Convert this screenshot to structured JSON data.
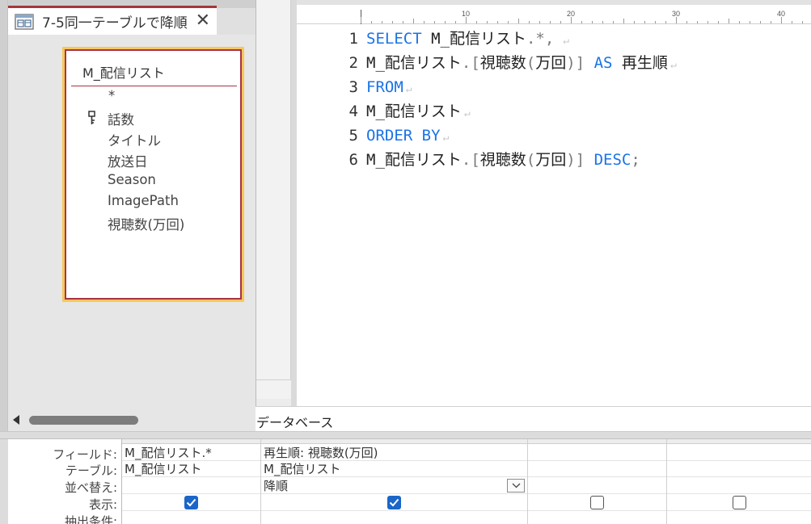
{
  "query_tab": {
    "title": "7-5同一テーブルで降順",
    "close_glyph": "✕"
  },
  "table_box": {
    "name": "M_配信リスト",
    "fields": [
      "*",
      "話数",
      "タイトル",
      "放送日",
      "Season",
      "ImagePath",
      "視聴数(万回)"
    ],
    "key_field_index": 1
  },
  "editor": {
    "ruler_numbers": [
      "10",
      "20",
      "30",
      "40"
    ],
    "lines": [
      {
        "num": "1",
        "tokens": [
          [
            "kw",
            "SELECT"
          ],
          [
            "",
            " M_配信リスト"
          ],
          [
            "pn",
            ".*,"
          ],
          [
            "nl",
            " ↵"
          ]
        ]
      },
      {
        "num": "2",
        "tokens": [
          [
            "",
            "M_配信リスト"
          ],
          [
            "pn",
            ".["
          ],
          [
            "",
            "視聴数"
          ],
          [
            "pn",
            "("
          ],
          [
            "",
            "万回"
          ],
          [
            "pn",
            ")]"
          ],
          [
            "kw",
            " AS "
          ],
          [
            "",
            "再生順"
          ],
          [
            "nl",
            "↵"
          ]
        ]
      },
      {
        "num": "3",
        "tokens": [
          [
            "kw",
            "FROM"
          ],
          [
            "nl",
            "↵"
          ]
        ]
      },
      {
        "num": "4",
        "tokens": [
          [
            "",
            "M_配信リスト"
          ],
          [
            "nl",
            "↵"
          ]
        ]
      },
      {
        "num": "5",
        "tokens": [
          [
            "kw",
            "ORDER BY"
          ],
          [
            "nl",
            "↵"
          ]
        ]
      },
      {
        "num": "6",
        "tokens": [
          [
            "",
            "M_配信リスト"
          ],
          [
            "pn",
            ".["
          ],
          [
            "",
            "視聴数"
          ],
          [
            "pn",
            "("
          ],
          [
            "",
            "万回"
          ],
          [
            "pn",
            ")]"
          ],
          [
            "kw",
            " DESC"
          ],
          [
            "pn",
            ";"
          ]
        ]
      }
    ]
  },
  "db_label": "データベース",
  "grid": {
    "row_labels": [
      "フィールド:",
      "テーブル:",
      "並べ替え:",
      "表示:",
      "抽出条件:"
    ],
    "columns": [
      {
        "field": "M_配信リスト.*",
        "table": "M_配信リスト",
        "sort": "",
        "show": true
      },
      {
        "field": "再生順: 視聴数(万回)",
        "table": "M_配信リスト",
        "sort": "降順",
        "show": true
      },
      {
        "field": "",
        "table": "",
        "sort": "",
        "show": false
      },
      {
        "field": "",
        "table": "",
        "sort": "",
        "show": false
      }
    ]
  },
  "colors": {
    "keyword": "#1a73e8",
    "table_border": "#a83344",
    "table_highlight": "#f7c75a",
    "checkbox_on": "#1a66c9",
    "tab_accent": "#a4373a"
  },
  "icons": {
    "tab": "query-icon",
    "key": "primary-key-icon",
    "checked": "checkbox-checked-icon",
    "dropdown": "chevron-down-icon"
  }
}
